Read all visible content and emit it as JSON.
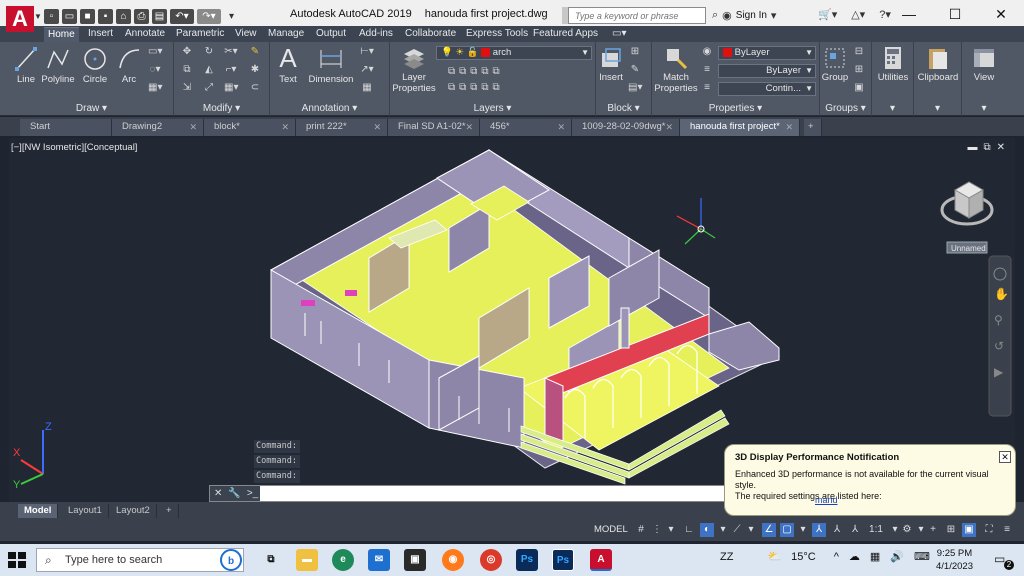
{
  "titlebar": {
    "app_name": "Autodesk AutoCAD 2019",
    "file_name": "hanouda first project.dwg",
    "logo_letter": "A",
    "search_placeholder": "Type a keyword or phrase",
    "sign_in": "Sign In",
    "help": "?"
  },
  "menu_tabs": [
    "Home",
    "Insert",
    "Annotate",
    "Parametric",
    "View",
    "Manage",
    "Output",
    "Add-ins",
    "Collaborate",
    "Express Tools",
    "Featured Apps"
  ],
  "ribbon": {
    "draw": {
      "title": "Draw",
      "tools": [
        "Line",
        "Polyline",
        "Circle",
        "Arc"
      ]
    },
    "modify": {
      "title": "Modify"
    },
    "annotation": {
      "title": "Annotation",
      "tools": [
        "Text",
        "Dimension"
      ]
    },
    "layers": {
      "title": "Layers",
      "tool_line1": "Layer",
      "tool_line2": "Properties",
      "current_layer": "arch"
    },
    "block": {
      "title": "Block",
      "tool": "Insert"
    },
    "properties": {
      "title": "Properties",
      "tool_line1": "Match",
      "tool_line2": "Properties",
      "color": "ByLayer",
      "lineweight": "ByLayer",
      "linetype": "Contin..."
    },
    "groups": {
      "title": "Groups",
      "tool": "Group"
    },
    "utilities": "Utilities",
    "clipboard": "Clipboard",
    "view": "View"
  },
  "doc_tabs": [
    {
      "label": "Start",
      "active": false
    },
    {
      "label": "Drawing2",
      "active": false
    },
    {
      "label": "block*",
      "active": false
    },
    {
      "label": "print 222*",
      "active": false
    },
    {
      "label": "Final SD A1-02*",
      "active": false
    },
    {
      "label": "456*",
      "active": false
    },
    {
      "label": "1009-28-02-09dwg*",
      "active": false
    },
    {
      "label": "hanouda first project*",
      "active": true
    }
  ],
  "viewport": {
    "label": "[−][NW Isometric][Conceptual]",
    "viewcube_label": "Unnamed",
    "ucs_x": "X",
    "ucs_y": "Y",
    "ucs_z": "Z"
  },
  "command": {
    "history": [
      "Command:",
      "Command:",
      "Command:"
    ],
    "input_value": "",
    "prompt_icon": ">_"
  },
  "notification": {
    "title": "3D Display Performance Notification",
    "body_line1": "Enhanced 3D performance is not available for the current visual style.",
    "body_line2": "The required settings are listed here:",
    "link": "mand"
  },
  "layout_tabs": [
    {
      "label": "Model",
      "active": true
    },
    {
      "label": "Layout1",
      "active": false
    },
    {
      "label": "Layout2",
      "active": false
    }
  ],
  "statusbar": {
    "model": "MODEL",
    "scale": "1:1"
  },
  "taskbar": {
    "search_placeholder": "Type here to search",
    "weather": "15°C",
    "time": "9:25 PM",
    "date": "4/1/2023",
    "notification_count": "2"
  },
  "colors": {
    "accent_red": "#c8102e",
    "ribbon_bg": "#505866",
    "viewport_bg": "#212733",
    "floor_yellow": "#e6f05a",
    "wall_lilac": "#8d86a8",
    "arch_red": "#e04050"
  }
}
